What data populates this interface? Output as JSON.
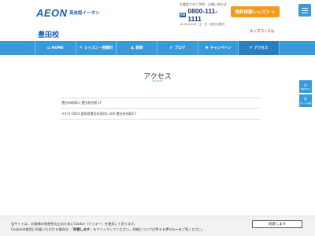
{
  "header": {
    "logo": "AEON",
    "logo_sub": "英会話イーオン",
    "contact_note": "お電話でのご予約・お問い合わせ",
    "fd_mark": "FD",
    "phone": "0800-111-1111",
    "hours": "10:00-20:00（土・日・祝日も受付）",
    "trial_button": "無料体験レッスン >"
  },
  "school": {
    "name": "豊田校",
    "kids_link": "キッズコースも"
  },
  "nav": {
    "items": [
      {
        "icon": "⌂",
        "label": "HOME"
      },
      {
        "icon": "✎",
        "label": "レッスン・授業料"
      },
      {
        "icon": "♟",
        "label": "教師"
      },
      {
        "icon": "✐",
        "label": "ブログ"
      },
      {
        "icon": "♣",
        "label": "キャンペーン"
      },
      {
        "icon": "⚲",
        "label": "アクセス"
      }
    ]
  },
  "main": {
    "title": "アクセス",
    "subtitle": "access",
    "location": "豊田市駅東口 豊田参合館３F",
    "address": "〒471-0025 愛知県豊田市西町1-200 豊田参合館2 F"
  },
  "side": {
    "buttons": [
      {
        "icon": "⌂",
        "label": "教室TOPへ"
      },
      {
        "icon": "⚲",
        "label": "スクール検索"
      }
    ]
  },
  "cookie": {
    "line1": "当サイトは、お客様の利便性向上のためにCookie（クッキー）を使用しております。",
    "line2_a": "Cookieの使用に同意いただける場合は、「",
    "line2_b": "同意します",
    "line2_c": "」をクリックしてください。詳細については",
    "policy": "サイトポリシー",
    "line2_d": "をご覧ください。",
    "agree": "同意します",
    "close": "×"
  },
  "colors": {
    "brand_blue": "#1a5fb4",
    "nav_blue": "#3a9ad9",
    "orange": "#f39a1e"
  }
}
